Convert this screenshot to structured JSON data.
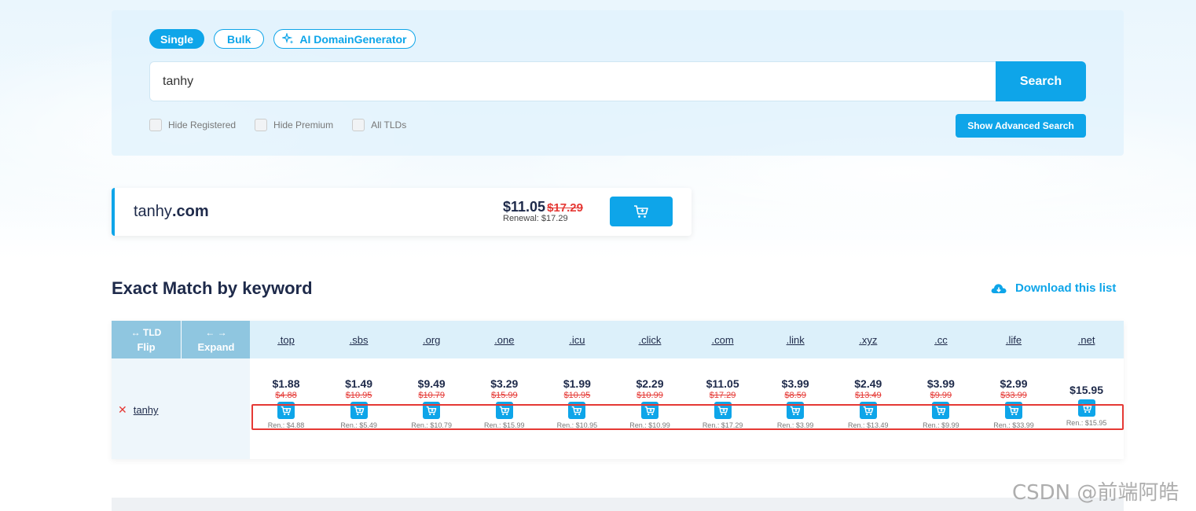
{
  "search": {
    "modes": [
      "Single",
      "Bulk",
      "AI DomainGenerator"
    ],
    "query": "tanhy",
    "button": "Search",
    "filters": [
      "Hide Registered",
      "Hide Premium",
      "All TLDs"
    ],
    "advanced_button": "Show Advanced Search"
  },
  "result": {
    "name": "tanhy",
    "tld": ".com",
    "price": "$11.05",
    "old_price": "$17.29",
    "renewal": "Renewal: $17.29"
  },
  "section": {
    "title": "Exact Match by keyword",
    "download": "Download this list"
  },
  "table": {
    "flip_icon": "↔ TLD",
    "flip": "Flip",
    "expand_icon": "← →",
    "expand": "Expand",
    "keyword": "tanhy",
    "columns": [
      {
        "tld": ".top",
        "price": "$1.88",
        "old": "$4.88",
        "ren": "Ren.: $4.88"
      },
      {
        "tld": ".sbs",
        "price": "$1.49",
        "old": "$10.95",
        "ren": "Ren.: $5.49"
      },
      {
        "tld": ".org",
        "price": "$9.49",
        "old": "$10.79",
        "ren": "Ren.: $10.79"
      },
      {
        "tld": ".one",
        "price": "$3.29",
        "old": "$15.99",
        "ren": "Ren.: $15.99"
      },
      {
        "tld": ".icu",
        "price": "$1.99",
        "old": "$10.95",
        "ren": "Ren.: $10.95"
      },
      {
        "tld": ".click",
        "price": "$2.29",
        "old": "$10.99",
        "ren": "Ren.: $10.99"
      },
      {
        "tld": ".com",
        "price": "$11.05",
        "old": "$17.29",
        "ren": "Ren.: $17.29"
      },
      {
        "tld": ".link",
        "price": "$3.99",
        "old": "$8.59",
        "ren": "Ren.: $3.99"
      },
      {
        "tld": ".xyz",
        "price": "$2.49",
        "old": "$13.49",
        "ren": "Ren.: $13.49"
      },
      {
        "tld": ".cc",
        "price": "$3.99",
        "old": "$9.99",
        "ren": "Ren.: $9.99"
      },
      {
        "tld": ".life",
        "price": "$2.99",
        "old": "$33.99",
        "ren": "Ren.: $33.99"
      },
      {
        "tld": ".net",
        "price": "$15.95",
        "old": "",
        "ren": "Ren.: $15.95"
      }
    ]
  },
  "watermark": "CSDN @前端阿皓",
  "colors": {
    "accent": "#0ea5e9",
    "strike": "#e53935",
    "header": "#dcf0fa"
  }
}
